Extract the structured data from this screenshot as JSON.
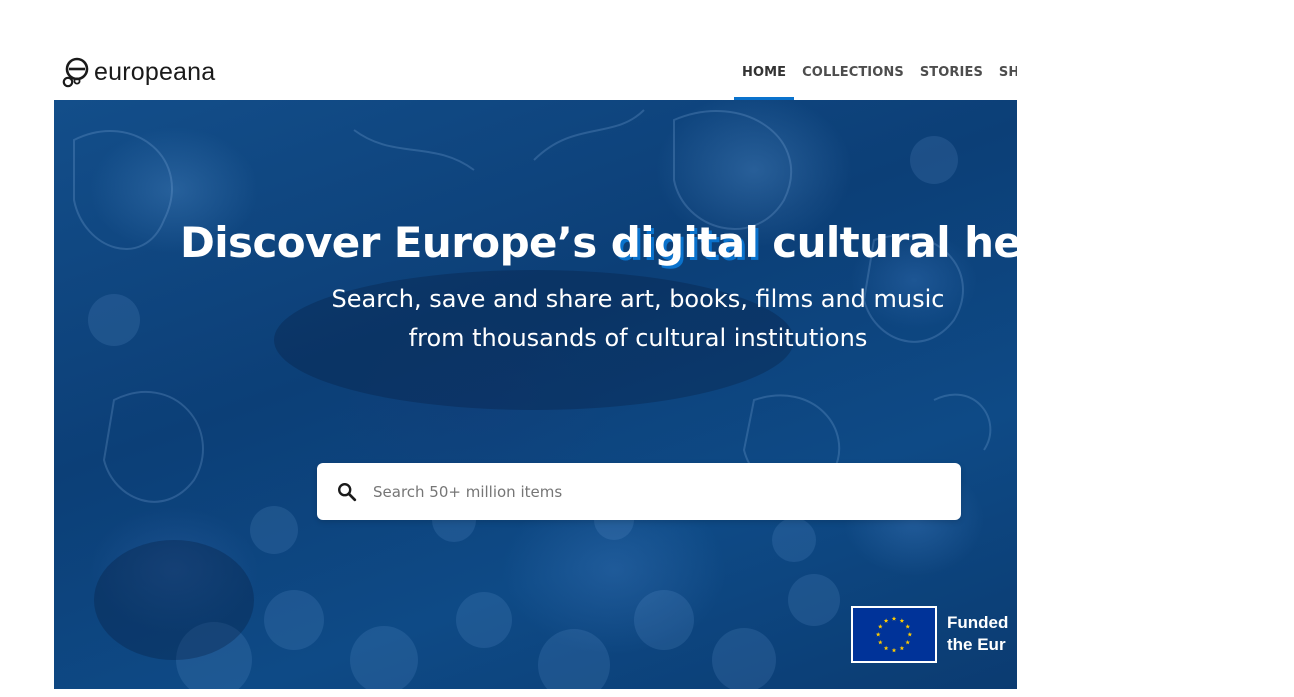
{
  "brand": {
    "logo_text": "europeana",
    "logo_icon": "europeana-logo-icon"
  },
  "nav": {
    "items": [
      {
        "label": "HOME",
        "active": true
      },
      {
        "label": "COLLECTIONS",
        "active": false
      },
      {
        "label": "STORIES",
        "active": false
      },
      {
        "label": "SHAR",
        "active": false
      }
    ]
  },
  "hero": {
    "title_before": "Discover Europe’s ",
    "title_highlight": "digital",
    "title_after": " cultural herit",
    "subtitle": "Search, save and share art, books, films and music from thousands of cultural institutions",
    "search": {
      "placeholder": "Search 50+ million items",
      "value": "",
      "icon": "search-icon"
    },
    "funding": {
      "text": "Funded\nthe Eur",
      "flag_icon": "eu-flag-icon"
    }
  },
  "colors": {
    "accent": "#0a72cc",
    "hero_tint": "#0c3f77",
    "nav_text": "#4d4d4d",
    "eu_blue": "#003399",
    "eu_star": "#ffcc00"
  }
}
